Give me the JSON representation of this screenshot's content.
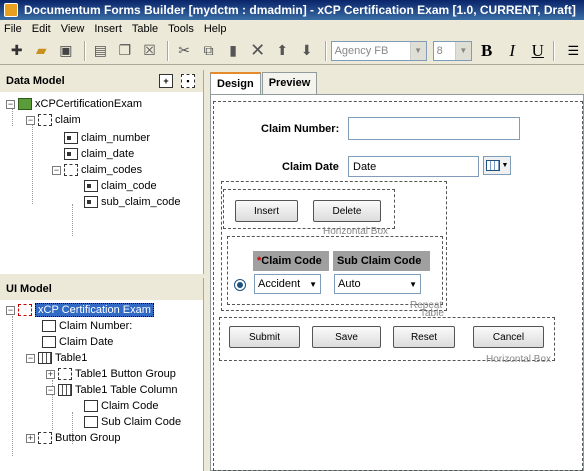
{
  "window": {
    "title": "Documentum Forms Builder [mydctm : dmadmin]  - xCP Certification Exam [1.0, CURRENT, Draft]"
  },
  "menu": [
    "File",
    "Edit",
    "View",
    "Insert",
    "Table",
    "Tools",
    "Help"
  ],
  "toolbar": {
    "font_name": "Agency FB",
    "font_size": "8",
    "bold": "B",
    "italic": "I",
    "underline": "U"
  },
  "data_model": {
    "title": "Data Model",
    "root": "xCPCertificationExam",
    "claim": "claim",
    "claim_number": "claim_number",
    "claim_date": "claim_date",
    "claim_codes": "claim_codes",
    "claim_code": "claim_code",
    "sub_claim_code": "sub_claim_code"
  },
  "ui_model": {
    "title": "UI Model",
    "root": "xCP Certification Exam",
    "claim_number": "Claim Number:",
    "claim_date": "Claim Date",
    "table1": "Table1",
    "table1_button_group": "Table1 Button Group",
    "table1_table_column": "Table1 Table Column",
    "claim_code": "Claim Code",
    "sub_claim_code": "Sub Claim Code",
    "button_group": "Button Group"
  },
  "tabs": {
    "design": "Design",
    "preview": "Preview"
  },
  "form": {
    "claim_number_label": "Claim Number:",
    "claim_number_value": "",
    "claim_date_label": "Claim Date",
    "claim_date_value": "Date",
    "insert": "Insert",
    "delete": "Delete",
    "horizontal_box": "Horizontal Box",
    "required_marker": "*",
    "claim_code_header": "Claim Code",
    "sub_claim_code_header": "Sub Claim Code",
    "claim_code_value": "Accident",
    "sub_claim_code_value": "Auto",
    "repeat_table_1": "Repeat",
    "repeat_table_2": "Table",
    "submit": "Submit",
    "save": "Save",
    "reset": "Reset",
    "cancel": "Cancel",
    "horizontal_box_2": "Horizontal Box"
  }
}
